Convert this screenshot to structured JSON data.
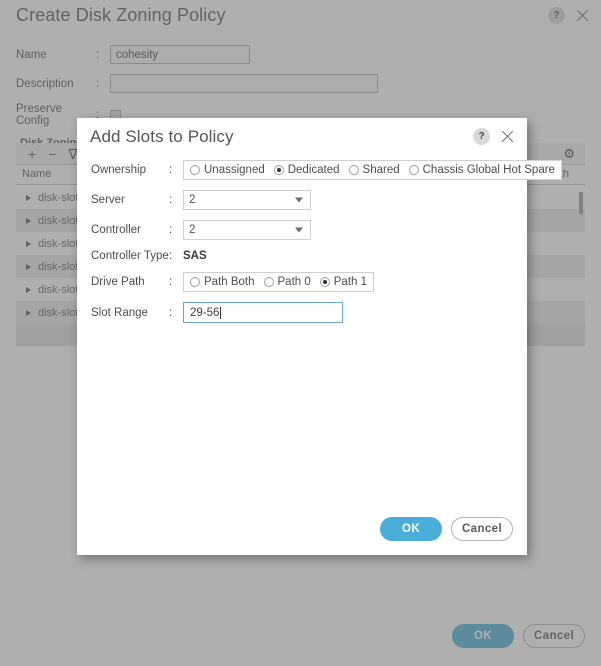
{
  "background": {
    "title": "Create Disk Zoning Policy",
    "help_icon": "help-icon",
    "help_glyph": "?",
    "close_icon": "close-icon",
    "form": {
      "name_label": "Name",
      "name_value": "cohesity",
      "description_label": "Description",
      "description_value": "",
      "preserve_config_label": "Preserve Config",
      "preserve_config_checked": false,
      "colon": ":"
    },
    "section_title": "Disk Zoning Information",
    "toolbar": {
      "add_label": "+",
      "remove_label": "−",
      "filter_label": "∇",
      "settings_label": "⚙"
    },
    "table": {
      "columns": [
        "Name",
        "Path"
      ],
      "rows": [
        {
          "name": "disk-slot"
        },
        {
          "name": "disk-slot"
        },
        {
          "name": "disk-slot"
        },
        {
          "name": "disk-slot"
        },
        {
          "name": "disk-slot"
        },
        {
          "name": "disk-slot"
        }
      ]
    },
    "footer": {
      "ok_label": "OK",
      "cancel_label": "Cancel"
    }
  },
  "modal": {
    "title": "Add Slots to Policy",
    "help_glyph": "?",
    "colon": ":",
    "fields": {
      "ownership": {
        "label": "Ownership",
        "options": [
          "Unassigned",
          "Dedicated",
          "Shared",
          "Chassis Global Hot Spare"
        ],
        "selected": "Dedicated"
      },
      "server": {
        "label": "Server",
        "value": "2"
      },
      "controller": {
        "label": "Controller",
        "value": "2"
      },
      "controller_type": {
        "label": "Controller Type",
        "value": "SAS"
      },
      "drive_path": {
        "label": "Drive Path",
        "options": [
          "Path Both",
          "Path 0",
          "Path 1"
        ],
        "selected": "Path 1"
      },
      "slot_range": {
        "label": "Slot Range",
        "value": "29-56"
      }
    },
    "footer": {
      "ok_label": "OK",
      "cancel_label": "Cancel"
    }
  },
  "colors": {
    "primary": "#49afd9",
    "focus_border": "#6ba7d6",
    "title_text": "#565656",
    "body_text": "#4d4d4d"
  }
}
